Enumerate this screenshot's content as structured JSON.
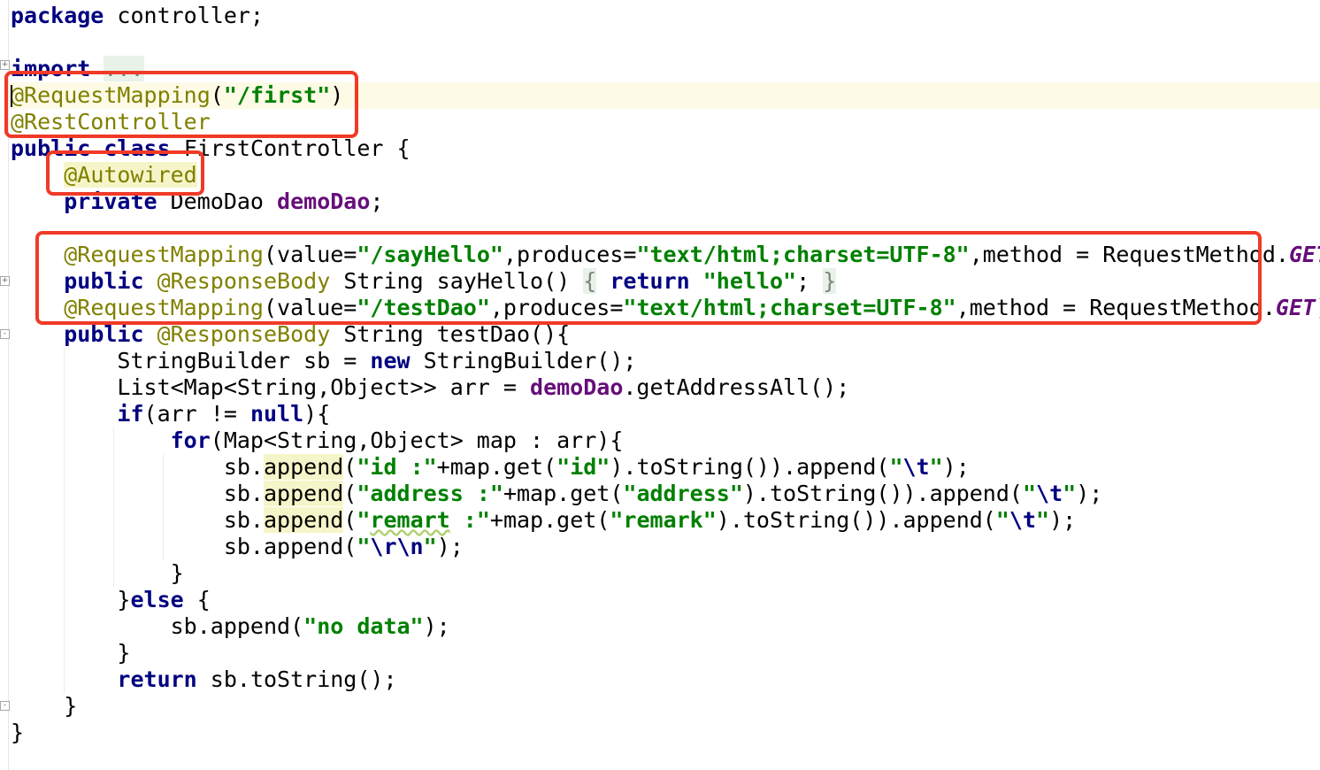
{
  "code": {
    "l1_package_kw": "package",
    "l1_rest": " controller;",
    "l3_import_kw": "import",
    "l3_fold": "...",
    "l4_ann": "@RequestMapping",
    "l4_open": "(",
    "l4_str": "\"/first\"",
    "l4_close": ")",
    "l5_ann": "@RestController",
    "l6_public": "public",
    "l6_class": "class",
    "l6_rest": " FirstController {",
    "l7_ann": "@Autowired",
    "l8_private": "private",
    "l8_type": " DemoDao ",
    "l8_field": "demoDao",
    "l8_semi": ";",
    "l10_ann": "@RequestMapping",
    "l10_p1": "(value=",
    "l10_s1": "\"/sayHello\"",
    "l10_p2": ",produces=",
    "l10_s2": "\"text/html;charset=UTF-8\"",
    "l10_p3": ",method = RequestMethod.",
    "l10_get": "GET",
    "l10_p4": ")",
    "l11_public": "public",
    "l11_ann": "@ResponseBody",
    "l11_rest": " String sayHello() ",
    "l11_fold_open": "{",
    "l11_return": "return",
    "l11_str": "\"hello\"",
    "l11_semi": ";",
    "l11_fold_close": "}",
    "l12_ann": "@RequestMapping",
    "l12_p1": "(value=",
    "l12_s1": "\"/testDao\"",
    "l12_p2": ",produces=",
    "l12_s2": "\"text/html;charset=UTF-8\"",
    "l12_p3": ",method = RequestMethod.",
    "l12_get": "GET",
    "l12_p4": ")",
    "l13_public": "public",
    "l13_ann": "@ResponseBody",
    "l13_rest": " String testDao(){",
    "l14_a": "StringBuilder sb = ",
    "l14_new": "new",
    "l14_b": " StringBuilder();",
    "l15_a": "List<Map<String,Object>> arr = ",
    "l15_field": "demoDao",
    "l15_b": ".getAddressAll();",
    "l16_if": "if",
    "l16_a": "(arr != ",
    "l16_null": "null",
    "l16_b": "){",
    "l17_for": "for",
    "l17_a": "(Map<String,Object> map : arr){",
    "l18_sb": "sb.",
    "l18_append": "append",
    "l18_a": "(",
    "l18_s1": "\"id :\"",
    "l18_b": "+map.get(",
    "l18_s2": "\"id\"",
    "l18_c": ").toString()).append(",
    "l18_s3q1": "\"",
    "l18_s3esc": "\\t",
    "l18_s3q2": "\"",
    "l18_d": ");",
    "l19_sb": "sb.",
    "l19_append": "append",
    "l19_a": "(",
    "l19_s1": "\"address :\"",
    "l19_b": "+map.get(",
    "l19_s2": "\"address\"",
    "l19_c": ").toString()).append(",
    "l19_s3q1": "\"",
    "l19_s3esc": "\\t",
    "l19_s3q2": "\"",
    "l19_d": ");",
    "l20_sb": "sb.",
    "l20_append": "append",
    "l20_a": "(",
    "l20_s1q": "\"",
    "l20_s1typo": "remart",
    "l20_s1rest": " :\"",
    "l20_b": "+map.get(",
    "l20_s2": "\"remark\"",
    "l20_c": ").toString()).append(",
    "l20_s3q1": "\"",
    "l20_s3esc": "\\t",
    "l20_s3q2": "\"",
    "l20_d": ");",
    "l21_a": "sb.append(",
    "l21_q1": "\"",
    "l21_esc": "\\r\\n",
    "l21_q2": "\"",
    "l21_b": ");",
    "l22": "}",
    "l23_a": "}",
    "l23_else": "else",
    "l23_b": " {",
    "l24_a": "sb.append(",
    "l24_str": "\"no data\"",
    "l24_b": ");",
    "l25": "}",
    "l26_return": "return",
    "l26_rest": " sb.toString();",
    "l27": "}",
    "l28": "}"
  },
  "colors": {
    "keyword": "#000080",
    "annotation": "#808000",
    "string": "#008000",
    "field": "#660e7a",
    "highlight_box": "#f03a27",
    "current_line": "#fdfae6"
  }
}
